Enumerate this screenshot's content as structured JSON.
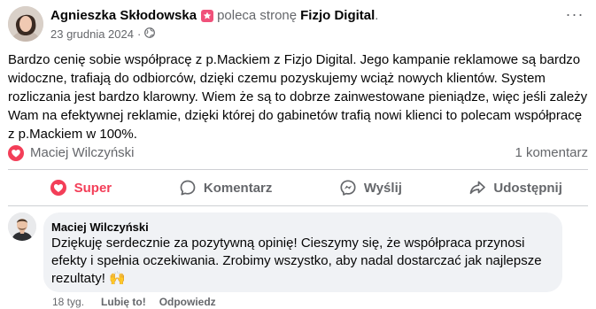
{
  "post": {
    "author": "Agnieszka Skłodowska",
    "recommend_text": "poleca stronę",
    "page_name": "Fizjo Digital",
    "period": ".",
    "date": "23 grudnia 2024",
    "dot": "·",
    "privacy_icon": "globe-icon",
    "more_icon": "more-options-icon",
    "more_glyph": "···",
    "body": "Bardzo cenię sobie współpracę z p.Mackiem z Fizjo Digital. Jego kampanie reklamowe są bardzo widoczne, trafiają do odbiorców, dzięki czemu pozyskujemy wciąż nowych klientów. System rozliczania jest bardzo klarowny. Wiem że są to dobrze zainwestowane pieniądze, więc jeśli zależy Wam na efektywnej reklamie, dzięki której do gabinetów trafią nowi klienci to polecam współpracę z p.Mackiem w 100%."
  },
  "stats": {
    "reactor": "Maciej Wilczyński",
    "reaction_icon": "heart-reaction-icon",
    "comment_count": "1 komentarz"
  },
  "actions": [
    {
      "label": "Super",
      "icon": "heart-icon",
      "active": true
    },
    {
      "label": "Komentarz",
      "icon": "comment-icon",
      "active": false
    },
    {
      "label": "Wyślij",
      "icon": "messenger-icon",
      "active": false
    },
    {
      "label": "Udostępnij",
      "icon": "share-icon",
      "active": false
    }
  ],
  "comment": {
    "author": "Maciej Wilczyński",
    "text": "Dziękuję serdecznie za pozytywną opinię! Cieszymy się, że współpraca przynosi efekty i spełnia oczekiwania. Zrobimy wszystko, aby nadal dostarczać jak najlepsze rezultaty! 🙌",
    "time": "18 tyg.",
    "like_label": "Lubię to!",
    "reply_label": "Odpowiedz"
  },
  "colors": {
    "text": "#050505",
    "secondary": "#65676b",
    "love": "#f33e58",
    "recommend": "#f0517a",
    "comment_bg": "#f0f2f5"
  }
}
